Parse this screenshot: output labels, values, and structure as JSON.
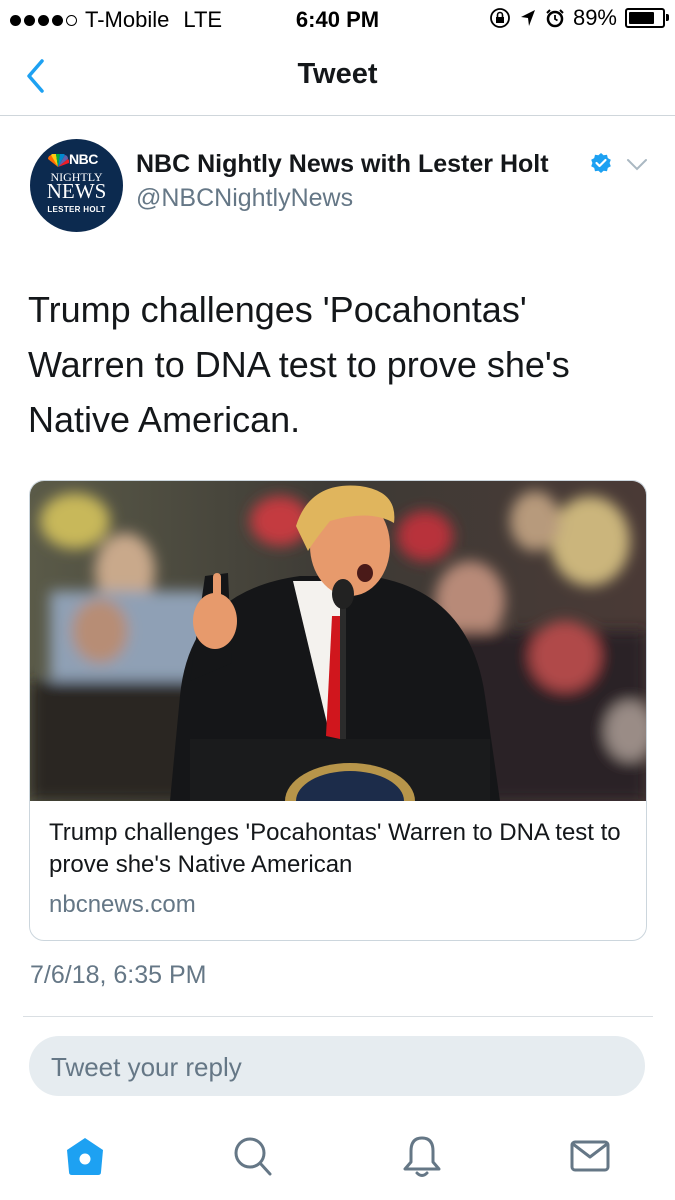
{
  "status_bar": {
    "carrier": "T-Mobile",
    "network": "LTE",
    "time": "6:40 PM",
    "battery": "89%",
    "battery_level": 0.89,
    "icons": [
      "signal-dots-icon",
      "rotation-lock-icon",
      "location-arrow-icon",
      "alarm-icon",
      "battery-icon"
    ]
  },
  "nav": {
    "title": "Tweet",
    "back_icon": "back-chevron-icon"
  },
  "tweet": {
    "author": {
      "name": "NBC Nightly News with Lester Holt",
      "handle": "@NBCNightlyNews",
      "verified": true,
      "avatar_text": {
        "brand": "NBC",
        "line1": "NIGHTLY",
        "line2": "NEWS",
        "line3": "LESTER HOLT"
      }
    },
    "text": "Trump challenges 'Pocahontas' Warren to DNA test to prove she's Native American.",
    "card": {
      "title": "Trump challenges 'Pocahontas' Warren to DNA test to prove she's Native American",
      "domain": "nbcnews.com"
    },
    "timestamp": "7/6/18, 6:35 PM"
  },
  "reply": {
    "placeholder": "Tweet your reply"
  },
  "tab_bar": {
    "items": [
      {
        "name": "home",
        "icon": "home-icon",
        "active": true
      },
      {
        "name": "search",
        "icon": "search-icon",
        "active": false
      },
      {
        "name": "notifications",
        "icon": "bell-icon",
        "active": false
      },
      {
        "name": "messages",
        "icon": "envelope-icon",
        "active": false
      }
    ]
  },
  "colors": {
    "accent": "#1da1f2",
    "text_primary": "#14171a",
    "text_secondary": "#657786",
    "reply_background": "#e6ecf0",
    "avatar_navy": "#0c2a4f"
  }
}
